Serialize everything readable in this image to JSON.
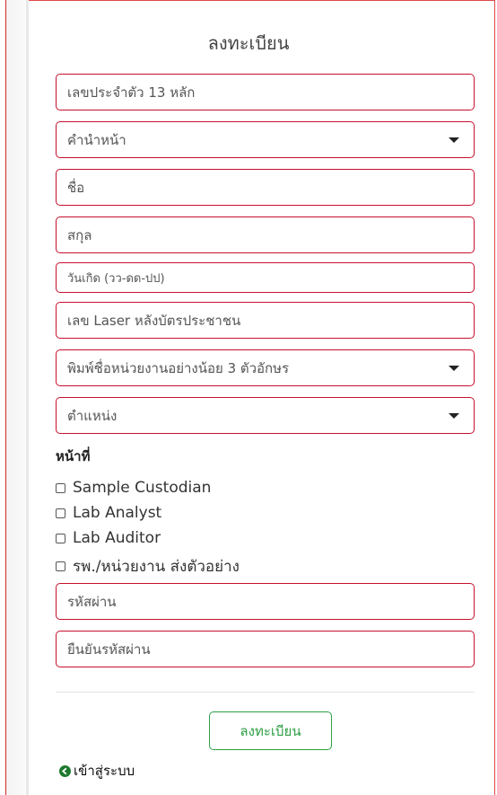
{
  "form": {
    "title": "ลงทะเบียน",
    "id_number_placeholder": "เลขประจำตัว 13 หลัก",
    "prefix_select": "คำนำหน้า",
    "first_name_placeholder": "ชื่อ",
    "last_name_placeholder": "สกุล",
    "birthdate_placeholder": "วันเกิด (วว-ดด-ปป)",
    "laser_id_placeholder": "เลข Laser หลังบัตรประชาชน",
    "agency_select": "พิมพ์ชื่อหน่วยงานอย่างน้อย 3 ตัวอักษร",
    "position_select": "ตำแหน่ง",
    "duty_label": "หน้าที่",
    "roles": [
      {
        "label": "Sample Custodian",
        "checked": false
      },
      {
        "label": "Lab Analyst",
        "checked": false
      },
      {
        "label": "Lab Auditor",
        "checked": false
      },
      {
        "label": "รพ./หน่วยงาน ส่งตัวอย่าง",
        "checked": false
      }
    ],
    "password_placeholder": "รหัสผ่าน",
    "confirm_password_placeholder": "ยืนยันรหัสผ่าน",
    "submit_label": "ลงทะเบียน",
    "login_link": "เข้าสู่ระบบ"
  },
  "colors": {
    "field_border": "#c8102e",
    "button_accent": "#2e9e44",
    "login_icon": "#1f7a2f"
  },
  "icons": {
    "dropdown": "chevron-down-icon",
    "login": "arrow-left-circle-icon"
  }
}
